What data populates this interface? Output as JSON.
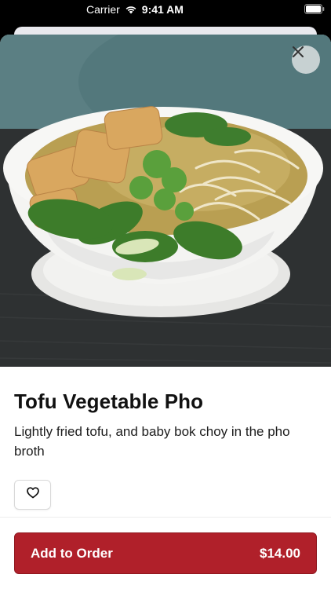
{
  "status_bar": {
    "carrier": "Carrier",
    "time": "9:41 AM"
  },
  "item": {
    "title": "Tofu Vegetable Pho",
    "description": "Lightly fried tofu, and baby bok choy in the pho broth",
    "image_icon": "pho-bowl-photo"
  },
  "actions": {
    "add_to_order_label": "Add to Order",
    "price": "$14.00"
  },
  "colors": {
    "accent": "#b0202a"
  }
}
